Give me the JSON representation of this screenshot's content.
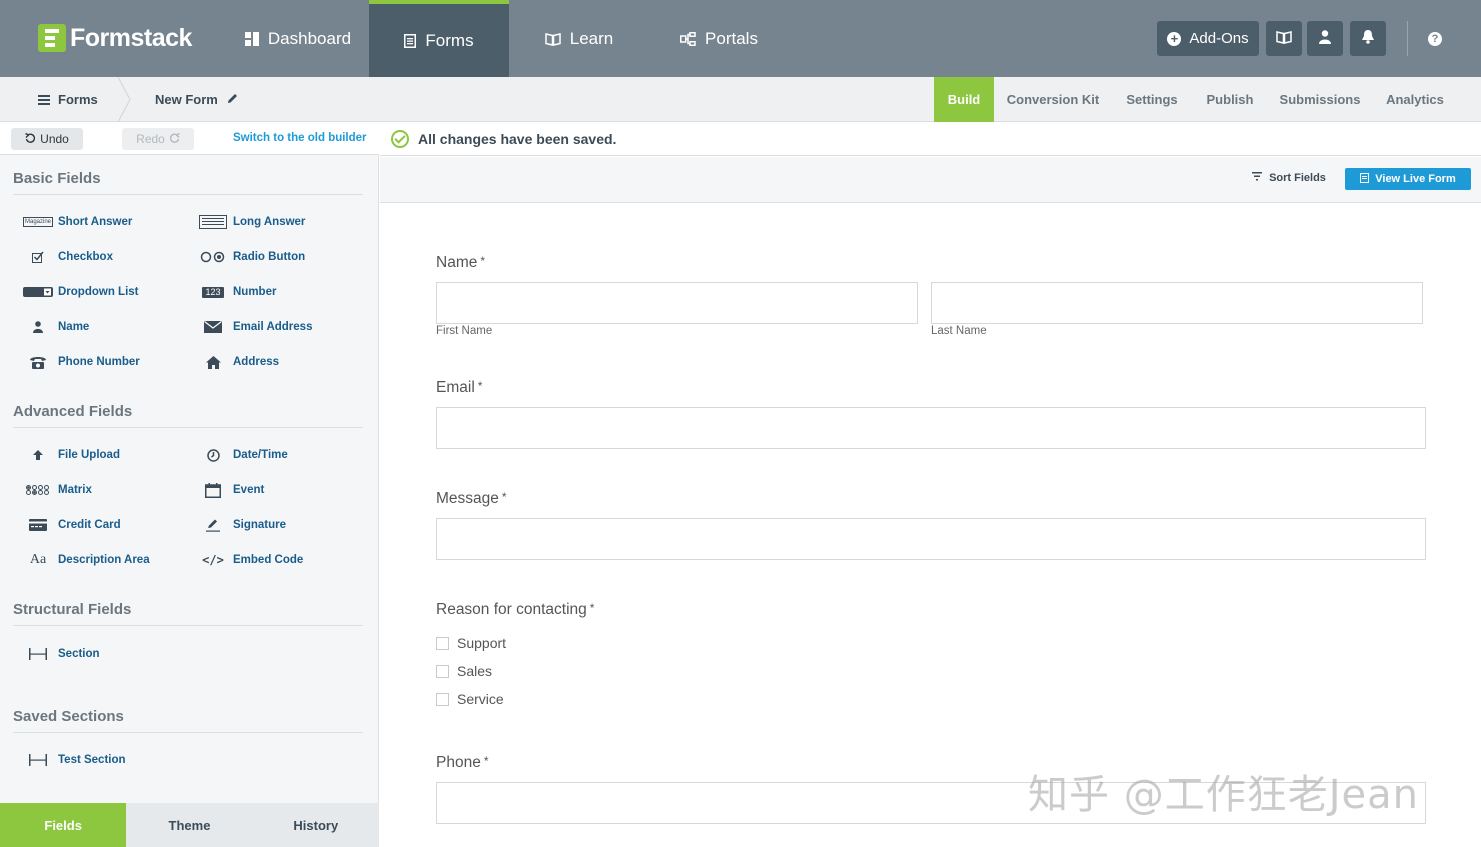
{
  "brand": {
    "name": "Formstack"
  },
  "topnav": {
    "items": [
      {
        "label": "Dashboard",
        "icon": "dashboard-icon"
      },
      {
        "label": "Forms",
        "icon": "forms-icon",
        "active": true
      },
      {
        "label": "Learn",
        "icon": "book-icon"
      },
      {
        "label": "Portals",
        "icon": "portals-icon"
      }
    ],
    "addons_label": "Add-Ons",
    "help": "?"
  },
  "breadcrumb": {
    "root": "Forms",
    "current": "New Form"
  },
  "tabs": [
    {
      "label": "Build",
      "active": true
    },
    {
      "label": "Conversion Kit"
    },
    {
      "label": "Settings"
    },
    {
      "label": "Publish"
    },
    {
      "label": "Submissions"
    },
    {
      "label": "Analytics"
    }
  ],
  "toolbar": {
    "undo": "Undo",
    "redo": "Redo",
    "switch_builder": "Switch to the old builder",
    "saved_status": "All changes have been saved.",
    "sort_fields": "Sort Fields",
    "view_live": "View Live Form"
  },
  "panel": {
    "basic_title": "Basic Fields",
    "basic": [
      {
        "label": "Short Answer",
        "icon": "Magazine"
      },
      {
        "label": "Long Answer"
      },
      {
        "label": "Checkbox"
      },
      {
        "label": "Radio Button"
      },
      {
        "label": "Dropdown List"
      },
      {
        "label": "Number",
        "icon": "123"
      },
      {
        "label": "Name"
      },
      {
        "label": "Email Address"
      },
      {
        "label": "Phone Number"
      },
      {
        "label": "Address"
      }
    ],
    "advanced_title": "Advanced Fields",
    "advanced": [
      {
        "label": "File Upload"
      },
      {
        "label": "Date/Time"
      },
      {
        "label": "Matrix"
      },
      {
        "label": "Event"
      },
      {
        "label": "Credit Card"
      },
      {
        "label": "Signature"
      },
      {
        "label": "Description Area",
        "icon": "Aa"
      },
      {
        "label": "Embed Code",
        "icon": "</>"
      }
    ],
    "structural_title": "Structural Fields",
    "structural": [
      {
        "label": "Section"
      }
    ],
    "saved_title": "Saved Sections",
    "saved": [
      {
        "label": "Test Section"
      }
    ]
  },
  "bottom_tabs": [
    {
      "label": "Fields",
      "active": true
    },
    {
      "label": "Theme"
    },
    {
      "label": "History"
    }
  ],
  "form": {
    "name_label": "Name",
    "first_name": "First Name",
    "last_name": "Last Name",
    "email_label": "Email",
    "message_label": "Message",
    "reason_label": "Reason for contacting",
    "reasons": [
      "Support",
      "Sales",
      "Service"
    ],
    "phone_label": "Phone",
    "required_mark": "*"
  },
  "watermark": "知乎 @工作狂老Jean",
  "colors": {
    "accent_green": "#8dc63f",
    "nav_gray": "#76848f",
    "nav_active": "#4d5e6b",
    "link_blue": "#1e9bd7"
  }
}
